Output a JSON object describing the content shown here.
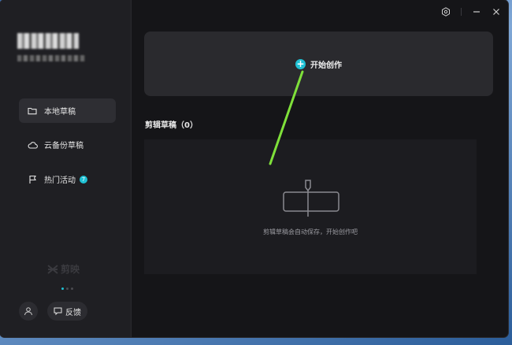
{
  "sidebar": {
    "items": [
      {
        "label": "本地草稿",
        "icon": "folder-icon",
        "active": true
      },
      {
        "label": "云备份草稿",
        "icon": "cloud-icon",
        "active": false
      },
      {
        "label": "热门活动",
        "icon": "flag-icon",
        "active": false,
        "badge": "7"
      }
    ],
    "watermark": "剪映",
    "feedback_label": "反馈"
  },
  "main": {
    "create_label": "开始创作",
    "drafts_title": "剪辑草稿（0）",
    "empty_message": "剪辑草稿会自动保存，开始创作吧"
  },
  "colors": {
    "accent": "#1fc1d4",
    "annotation_arrow": "#7fe03a"
  }
}
